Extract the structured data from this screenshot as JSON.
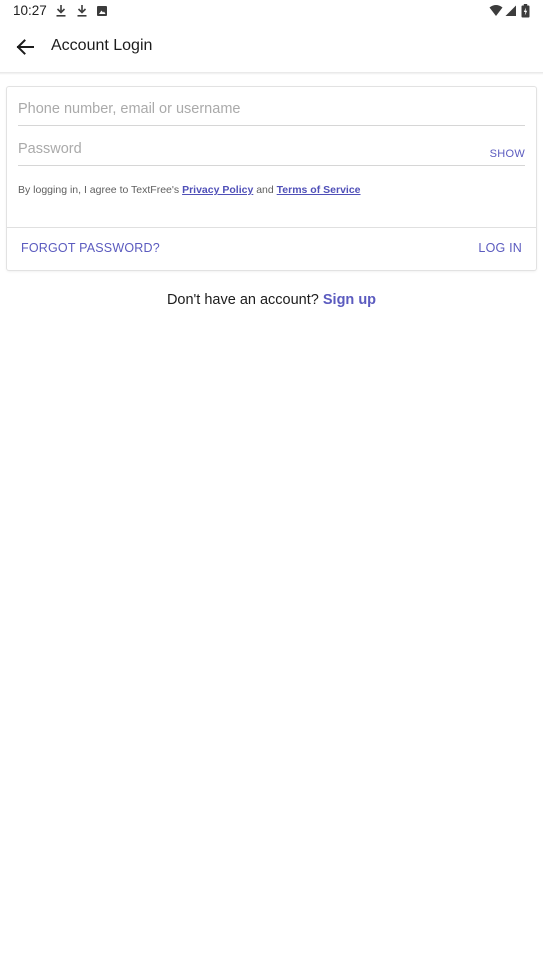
{
  "status_bar": {
    "time": "10:27",
    "notification_icons": [
      "download-icon",
      "download-icon",
      "photo-icon"
    ],
    "system_icons": [
      "wifi-icon",
      "signal-icon",
      "battery-icon"
    ]
  },
  "app_bar": {
    "back_icon": "arrow-back-icon",
    "title": "Account Login"
  },
  "login_form": {
    "username_placeholder": "Phone number, email or username",
    "username_value": "",
    "password_placeholder": "Password",
    "password_value": "",
    "show_label": "SHOW",
    "terms_prefix": "By logging in, I agree to TextFree's ",
    "privacy_policy_label": "Privacy Policy",
    "terms_and": " and ",
    "terms_of_service_label": "Terms of Service",
    "forgot_password_label": "FORGOT PASSWORD?",
    "login_label": "LOG IN"
  },
  "signup": {
    "prompt": "Don't have an account? ",
    "link_label": "Sign up"
  },
  "colors": {
    "accent": "#5b5bbf",
    "link": "#5050b8",
    "text": "#1c1c1c",
    "placeholder": "#aaaaaa",
    "background": "#ffffff"
  }
}
